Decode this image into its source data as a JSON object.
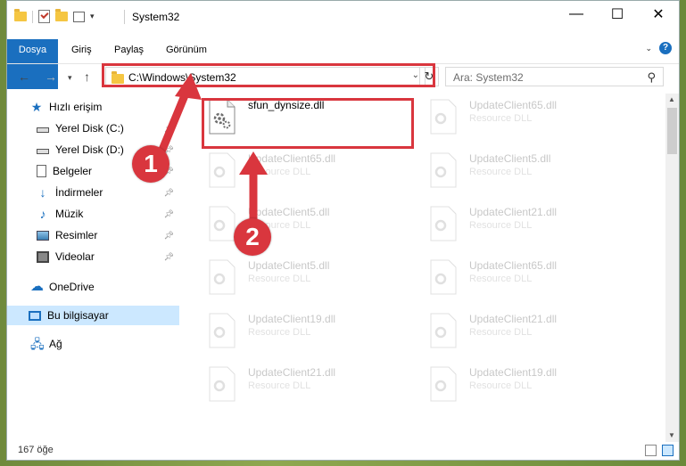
{
  "window": {
    "title": "System32"
  },
  "ribbon": {
    "tabs": [
      "Dosya",
      "Giriş",
      "Paylaş",
      "Görünüm"
    ]
  },
  "address": {
    "path": "C:\\Windows\\System32"
  },
  "search": {
    "placeholder": "Ara: System32"
  },
  "sidebar": {
    "items": [
      {
        "label": "Hızlı erişim",
        "icon": "star-icon"
      },
      {
        "label": "Yerel Disk (C:)",
        "icon": "drive-icon",
        "pinned": true
      },
      {
        "label": "Yerel Disk (D:)",
        "icon": "drive-icon",
        "pinned": true
      },
      {
        "label": "Belgeler",
        "icon": "documents-icon",
        "pinned": true
      },
      {
        "label": "İndirmeler",
        "icon": "download-icon",
        "pinned": true
      },
      {
        "label": "Müzik",
        "icon": "music-icon",
        "pinned": true
      },
      {
        "label": "Resimler",
        "icon": "pictures-icon",
        "pinned": true
      },
      {
        "label": "Videolar",
        "icon": "videos-icon",
        "pinned": true
      },
      {
        "label": "OneDrive",
        "icon": "onedrive-icon"
      },
      {
        "label": "Bu bilgisayar",
        "icon": "this-pc-icon",
        "selected": true
      },
      {
        "label": "Ağ",
        "icon": "network-icon"
      }
    ]
  },
  "files": [
    {
      "name": "sfun_dynsize.dll",
      "type": ""
    },
    {
      "name": "UpdateClient65.dll",
      "type": "Resource DLL"
    },
    {
      "name": "UpdateClient65.dll",
      "type": "Resource DLL"
    },
    {
      "name": "UpdateClient5.dll",
      "type": "Resource DLL"
    },
    {
      "name": "UpdateClient5.dll",
      "type": "Resource DLL"
    },
    {
      "name": "UpdateClient21.dll",
      "type": "Resource DLL"
    },
    {
      "name": "UpdateClient5.dll",
      "type": "Resource DLL"
    },
    {
      "name": "UpdateClient65.dll",
      "type": "Resource DLL"
    },
    {
      "name": "UpdateClient19.dll",
      "type": "Resource DLL"
    },
    {
      "name": "UpdateClient21.dll",
      "type": "Resource DLL"
    },
    {
      "name": "UpdateClient21.dll",
      "type": "Resource DLL"
    },
    {
      "name": "UpdateClient19.dll",
      "type": "Resource DLL"
    }
  ],
  "status": {
    "count": "167 öğe"
  },
  "annotations": {
    "badge1": "1",
    "badge2": "2"
  },
  "colors": {
    "accent": "#1a6fbf",
    "highlight": "#d9363e"
  }
}
